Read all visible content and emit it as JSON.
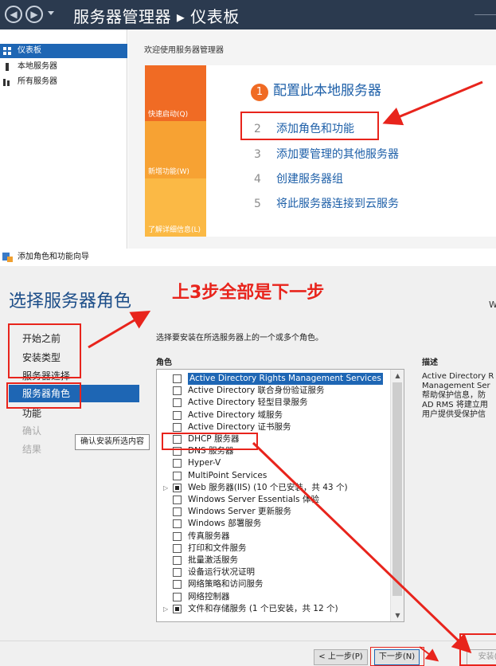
{
  "server_manager": {
    "title": "服务器管理器 ▸ 仪表板",
    "nav_back": "◀",
    "nav_forward": "▶",
    "sidebar": [
      {
        "label": "仪表板",
        "icon": "dashboard-icon",
        "active": true
      },
      {
        "label": "本地服务器",
        "icon": "server-icon",
        "active": false
      },
      {
        "label": "所有服务器",
        "icon": "servers-icon",
        "active": false
      }
    ],
    "welcome": "欢迎使用服务器管理器",
    "quick_blocks": [
      "快速启动(Q)",
      "新增功能(W)",
      "了解详细信息(L)"
    ],
    "steps": [
      {
        "num": "1",
        "label": "配置此本地服务器"
      },
      {
        "num": "2",
        "label": "添加角色和功能"
      },
      {
        "num": "3",
        "label": "添加要管理的其他服务器"
      },
      {
        "num": "4",
        "label": "创建服务器组"
      },
      {
        "num": "5",
        "label": "将此服务器连接到云服务"
      }
    ]
  },
  "wizard": {
    "window_title": "添加角色和功能向导",
    "heading": "选择服务器角色",
    "right_partial": "W",
    "annotation": "上3步全部是下一步",
    "nav": [
      "开始之前",
      "安装类型",
      "服务器选择",
      "服务器角色",
      "功能",
      "确认",
      "结果"
    ],
    "tooltip": "确认安装所选内容",
    "instruction": "选择要安装在所选服务器上的一个或多个角色。",
    "roles_header": "角色",
    "desc_header": "描述",
    "description_lines": [
      "Active Directory R",
      "Management Ser",
      "帮助保护信息，防",
      "AD RMS 将建立用",
      "用户提供受保护信"
    ],
    "roles": [
      {
        "label": "Active Directory Rights Management Services",
        "expander": "",
        "state": "empty",
        "selected": true
      },
      {
        "label": "Active Directory 联合身份验证服务",
        "expander": "",
        "state": "empty",
        "selected": false
      },
      {
        "label": "Active Directory 轻型目录服务",
        "expander": "",
        "state": "empty",
        "selected": false
      },
      {
        "label": "Active Directory 域服务",
        "expander": "",
        "state": "empty",
        "selected": false
      },
      {
        "label": "Active Directory 证书服务",
        "expander": "",
        "state": "empty",
        "selected": false
      },
      {
        "label": "DHCP 服务器",
        "expander": "",
        "state": "empty",
        "selected": false
      },
      {
        "label": "DNS 服务器",
        "expander": "",
        "state": "empty",
        "selected": false
      },
      {
        "label": "Hyper-V",
        "expander": "",
        "state": "empty",
        "selected": false
      },
      {
        "label": "MultiPoint Services",
        "expander": "",
        "state": "empty",
        "selected": false
      },
      {
        "label": "Web 服务器(IIS) (10 个已安装，共 43 个)",
        "expander": "▷",
        "state": "partial",
        "selected": false
      },
      {
        "label": "Windows Server Essentials 体验",
        "expander": "",
        "state": "empty",
        "selected": false
      },
      {
        "label": "Windows Server 更新服务",
        "expander": "",
        "state": "empty",
        "selected": false
      },
      {
        "label": "Windows 部署服务",
        "expander": "",
        "state": "empty",
        "selected": false
      },
      {
        "label": "传真服务器",
        "expander": "",
        "state": "empty",
        "selected": false
      },
      {
        "label": "打印和文件服务",
        "expander": "",
        "state": "empty",
        "selected": false
      },
      {
        "label": "批量激活服务",
        "expander": "",
        "state": "empty",
        "selected": false
      },
      {
        "label": "设备运行状况证明",
        "expander": "",
        "state": "empty",
        "selected": false
      },
      {
        "label": "网络策略和访问服务",
        "expander": "",
        "state": "empty",
        "selected": false
      },
      {
        "label": "网络控制器",
        "expander": "",
        "state": "empty",
        "selected": false
      },
      {
        "label": "文件和存储服务 (1 个已安装，共 12 个)",
        "expander": "▷",
        "state": "partial",
        "selected": false
      }
    ],
    "scroll_up": "▲",
    "scroll_down": "▼",
    "buttons": {
      "prev": "< 上一步(P)",
      "next": "下一步(N) >",
      "install": "安装(I)"
    }
  },
  "colors": {
    "accent": "#1e66b4",
    "annotation_red": "#e8241c",
    "tile_orange": "#f06b24"
  }
}
